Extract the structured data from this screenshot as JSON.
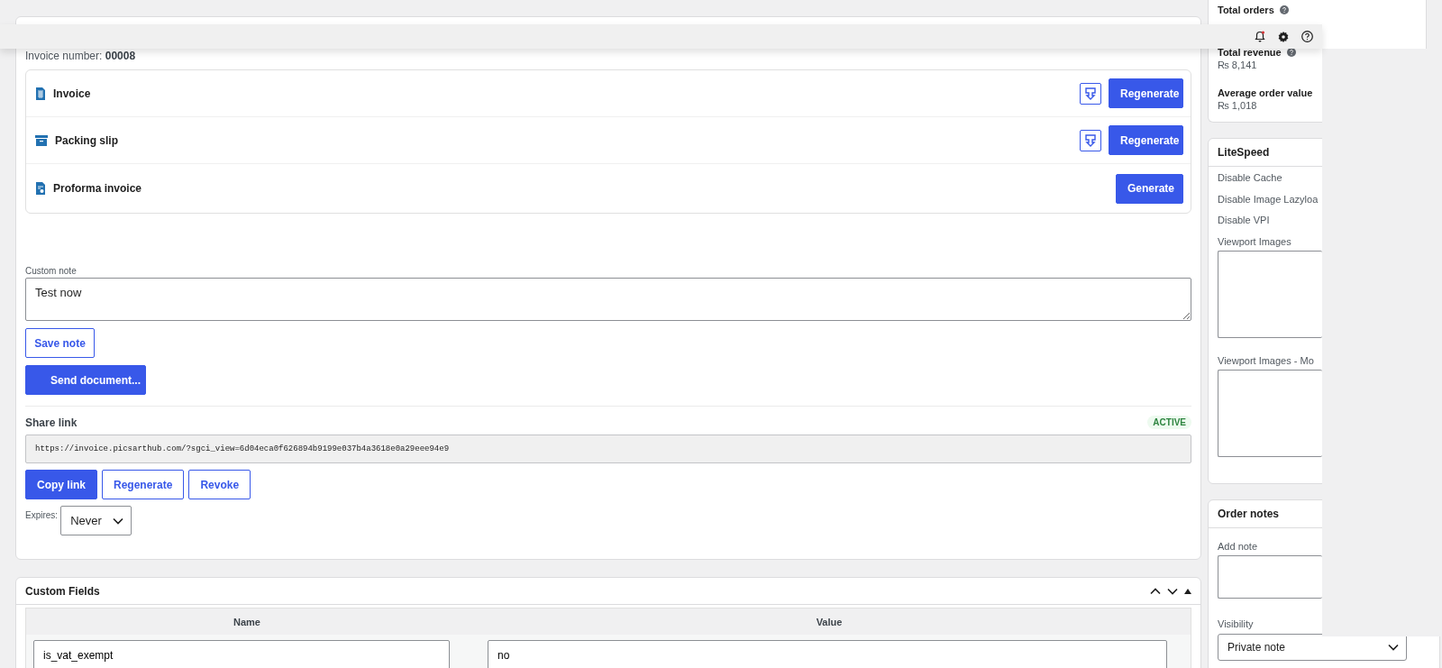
{
  "invoice_panel": {
    "invoice_number_label": "Invoice number:",
    "invoice_number": "00008",
    "documents": [
      {
        "name": "Invoice",
        "kind": "invoice",
        "has_download": true,
        "action": "Regenerate"
      },
      {
        "name": "Packing slip",
        "kind": "packing_slip",
        "has_download": true,
        "action": "Regenerate"
      },
      {
        "name": "Proforma invoice",
        "kind": "proforma",
        "has_download": false,
        "action": "Generate"
      }
    ],
    "custom_note": {
      "label": "Custom note",
      "value": "Test now"
    },
    "save_note": "Save note",
    "send_document": "Send document...",
    "share_link": {
      "label": "Share link",
      "status": "ACTIVE",
      "url": "https://invoice.picsarthub.com/?sgci_view=6d04eca0f626894b9199e037b4a3618e0a29eee94e9",
      "buttons": [
        {
          "label": "Copy link",
          "kind": "primary"
        },
        {
          "label": "Regenerate",
          "kind": "secondary"
        },
        {
          "label": "Revoke",
          "kind": "secondary"
        }
      ]
    },
    "expires": {
      "label": "Expires:",
      "value": "Never"
    }
  },
  "custom_fields": {
    "title": "Custom Fields",
    "columns": [
      "Name",
      "Value"
    ],
    "rows": [
      {
        "name": "is_vat_exempt",
        "value": "no"
      }
    ]
  },
  "sidebar": {
    "stats": [
      {
        "label": "Total orders",
        "has_help": true
      },
      {
        "label": "Total revenue",
        "value": "₨ 8,141",
        "has_help": true
      },
      {
        "label": "Average order value",
        "value": "₨ 1,018",
        "has_help": false
      }
    ],
    "litespeed": {
      "title": "LiteSpeed",
      "options": [
        "Disable Cache",
        "Disable Image Lazyloa",
        "Disable VPI"
      ],
      "fields": [
        {
          "label": "Viewport Images"
        },
        {
          "label": "Viewport Images - Mo"
        }
      ]
    },
    "order_notes": {
      "title": "Order notes",
      "add_note_label": "Add note",
      "visibility_label": "Visibility",
      "visibility": "Private note"
    }
  }
}
